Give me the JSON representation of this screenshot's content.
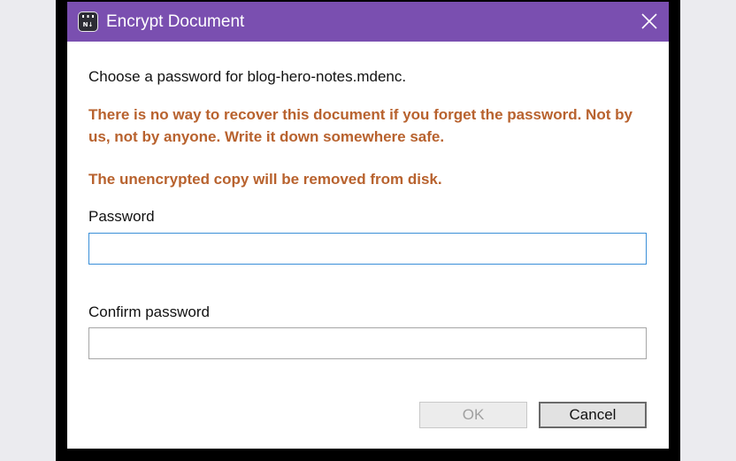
{
  "window": {
    "title": "Encrypt Document",
    "app_icon": "notes-app-icon",
    "titlebar_color": "#7a4fb0",
    "close_icon": "close-icon"
  },
  "dialog": {
    "prompt": "Choose a password for blog-hero-notes.mdenc.",
    "warning_lines": [
      "There is no way to recover this document if you forget the password. Not by us, not by anyone. Write it down somewhere safe.",
      "The unencrypted copy will be removed from disk."
    ],
    "warning_color": "#b8622e",
    "password_label": "Password",
    "password_value": "",
    "confirm_label": "Confirm password",
    "confirm_value": ""
  },
  "buttons": {
    "ok_label": "OK",
    "ok_enabled": false,
    "cancel_label": "Cancel"
  }
}
